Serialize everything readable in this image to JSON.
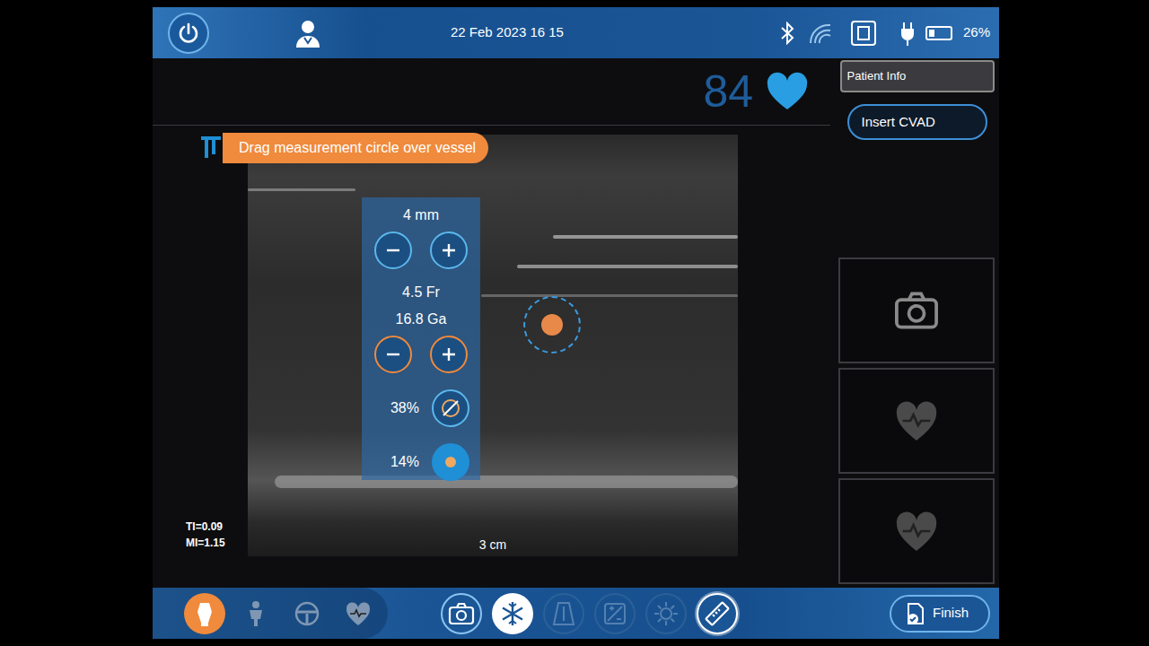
{
  "status_bar": {
    "datetime": "22 Feb 2023 16 15",
    "battery": "26%",
    "level": 0.26
  },
  "heart_rate": "84",
  "side_buttons": [
    {
      "label": "Patient Info",
      "selected": true
    },
    {
      "label": "Insert CVAD",
      "selected": false
    }
  ],
  "thumbnails": [
    {
      "kind": "camera"
    },
    {
      "kind": "heart"
    },
    {
      "kind": "heart"
    }
  ],
  "image": {
    "hint": "Drag measurement circle over vessel",
    "ti": "TI=0.09",
    "mi": "MI=1.15",
    "depth": "3 cm"
  },
  "measurement": {
    "vessel": "4 mm",
    "catheter_fr": "4.5 Fr",
    "catheter_ga": "16.8 Ga",
    "ratio": "38%",
    "area": "14%"
  },
  "modes": [
    {
      "kind": "probe",
      "selected": true
    },
    {
      "kind": "body",
      "selected": false
    },
    {
      "kind": "steering",
      "selected": false
    },
    {
      "kind": "heart",
      "selected": false
    }
  ],
  "tools": [
    {
      "kind": "camera",
      "selected": false,
      "disabled": false
    },
    {
      "kind": "freeze",
      "selected": true,
      "disabled": false
    },
    {
      "kind": "depth",
      "selected": false,
      "disabled": true
    },
    {
      "kind": "gain",
      "selected": false,
      "disabled": true
    },
    {
      "kind": "brightness",
      "selected": false,
      "disabled": true
    },
    {
      "kind": "measure",
      "selected": true,
      "disabled": false
    }
  ],
  "finish": "Finish"
}
